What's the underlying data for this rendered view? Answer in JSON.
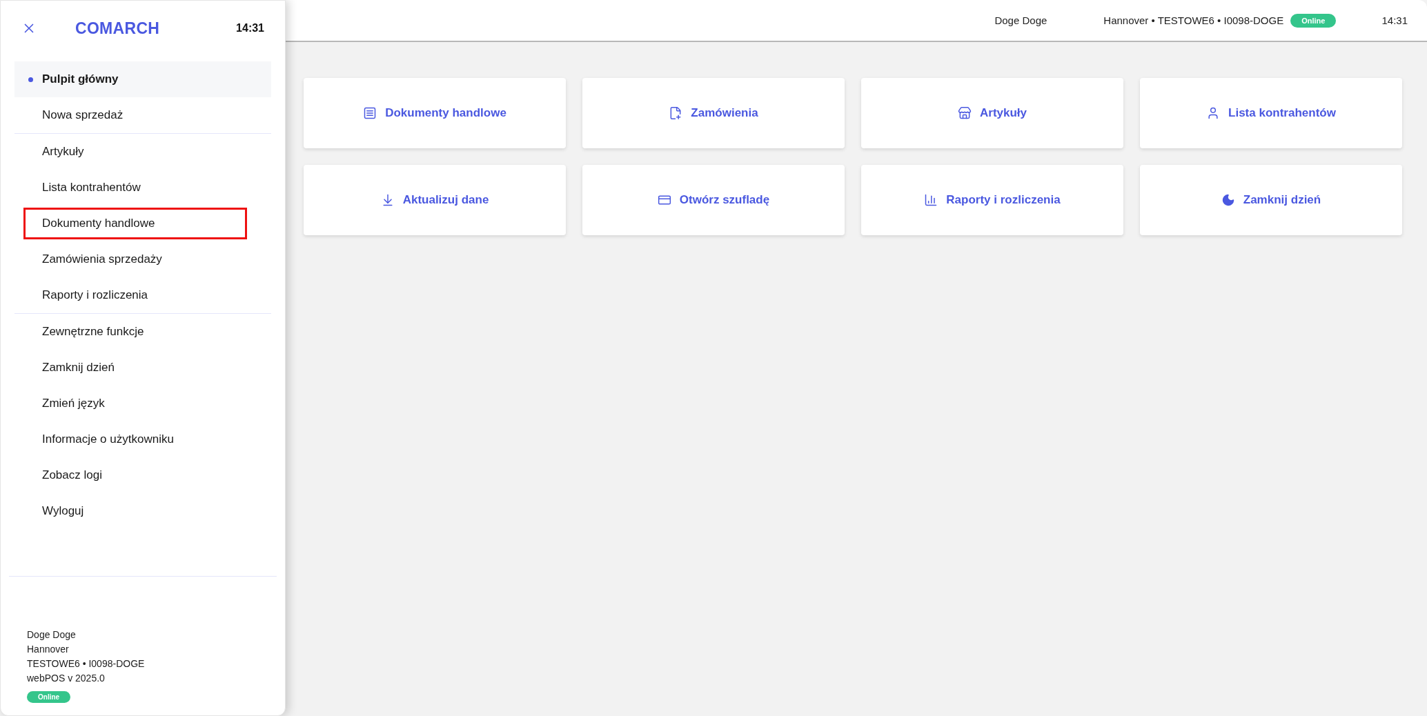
{
  "header": {
    "user": "Doge Doge",
    "location": "Hannover • TESTOWE6 • I0098-DOGE",
    "status": {
      "label": "Online",
      "online": true
    },
    "time": "14:31"
  },
  "sidebar": {
    "brand": "COMARCH",
    "time": "14:31",
    "sections": [
      {
        "items": [
          {
            "label": "Pulpit główny",
            "selected": true,
            "highlighted": false
          },
          {
            "label": "Nowa sprzedaż",
            "selected": false,
            "highlighted": false
          }
        ]
      },
      {
        "items": [
          {
            "label": "Artykuły",
            "selected": false,
            "highlighted": false
          },
          {
            "label": "Lista kontrahentów",
            "selected": false,
            "highlighted": false
          },
          {
            "label": "Dokumenty handlowe",
            "selected": false,
            "highlighted": true
          },
          {
            "label": "Zamówienia sprzedaży",
            "selected": false,
            "highlighted": false
          },
          {
            "label": "Raporty i rozliczenia",
            "selected": false,
            "highlighted": false
          }
        ]
      },
      {
        "items": [
          {
            "label": "Zewnętrzne funkcje",
            "selected": false,
            "highlighted": false
          },
          {
            "label": "Zamknij dzień",
            "selected": false,
            "highlighted": false
          },
          {
            "label": "Zmień język",
            "selected": false,
            "highlighted": false
          },
          {
            "label": "Informacje o użytkowniku",
            "selected": false,
            "highlighted": false
          },
          {
            "label": "Zobacz logi",
            "selected": false,
            "highlighted": false
          },
          {
            "label": "Wyloguj",
            "selected": false,
            "highlighted": false
          }
        ]
      }
    ],
    "footer": {
      "lines": [
        "Doge Doge",
        "Hannover",
        "TESTOWE6 • I0098-DOGE",
        "webPOS v 2025.0"
      ],
      "status": {
        "label": "Online",
        "online": true
      }
    }
  },
  "tiles": [
    {
      "label": "Dokumenty handlowe"
    },
    {
      "label": "Zamówienia"
    },
    {
      "label": "Artykuły"
    },
    {
      "label": "Lista kontrahentów"
    },
    {
      "label": "Aktualizuj dane"
    },
    {
      "label": "Otwórz szufladę"
    },
    {
      "label": "Raporty i rozliczenia"
    },
    {
      "label": "Zamknij dzień"
    }
  ]
}
